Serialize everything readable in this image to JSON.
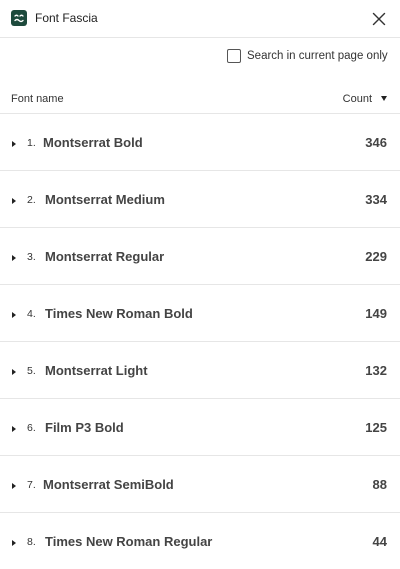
{
  "app": {
    "title": "Font Fascia",
    "icon": "font-fascia-logo-icon",
    "close_icon": "close-icon"
  },
  "search": {
    "label": "Search in current page only",
    "checked": false
  },
  "columns": {
    "font_name": "Font name",
    "count": "Count",
    "sort_icon": "sort-desc-icon"
  },
  "fonts": [
    {
      "index": "1.",
      "name": "Montserrat Bold",
      "count": "346"
    },
    {
      "index": "2.",
      "name": "Montserrat Medium",
      "count": "334"
    },
    {
      "index": "3.",
      "name": "Montserrat Regular",
      "count": "229"
    },
    {
      "index": "4.",
      "name": "Times New Roman Bold",
      "count": "149"
    },
    {
      "index": "5.",
      "name": "Montserrat Light",
      "count": "132"
    },
    {
      "index": "6.",
      "name": "Film P3 Bold",
      "count": "125"
    },
    {
      "index": "7.",
      "name": "Montserrat SemiBold",
      "count": "88"
    },
    {
      "index": "8.",
      "name": "Times New Roman Regular",
      "count": "44"
    }
  ],
  "colors": {
    "brand": "#1d4a3c",
    "divider": "#e6e6e6",
    "text": "#444444"
  }
}
